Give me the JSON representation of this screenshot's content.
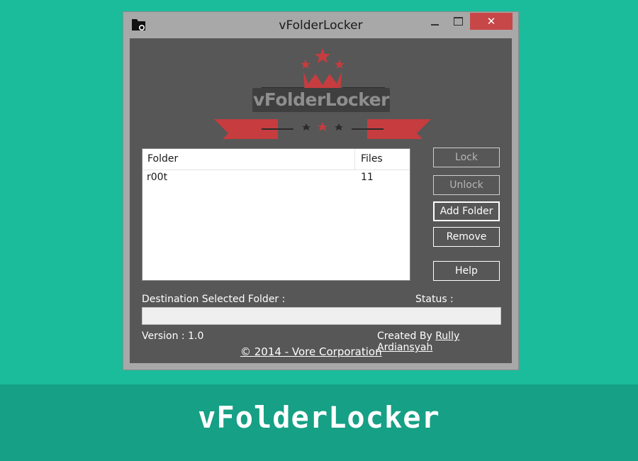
{
  "window": {
    "title": "vFolderLocker",
    "close_glyph": "✕"
  },
  "logo": {
    "text": "vFolderLocker",
    "accent": "#c63c3f"
  },
  "folder_list": {
    "columns": [
      "Folder",
      "Files"
    ],
    "rows": [
      {
        "folder": "r00t",
        "files": "11"
      }
    ]
  },
  "buttons": {
    "lock": "Lock",
    "unlock": "Unlock",
    "add_folder": "Add Folder",
    "remove": "Remove",
    "help": "Help"
  },
  "labels": {
    "destination": "Destination Selected Folder :",
    "status": "Status :",
    "version": "Version : 1.0",
    "created_by": "Created By",
    "author": "Rully Ardiansyah",
    "copyright": "© 2014 - Vore Corporation"
  },
  "banner": {
    "title": "vFolderLocker"
  },
  "colors": {
    "background": "#1bbc9b",
    "banner": "#16a085",
    "client": "#575757",
    "close_button": "#c74748"
  }
}
